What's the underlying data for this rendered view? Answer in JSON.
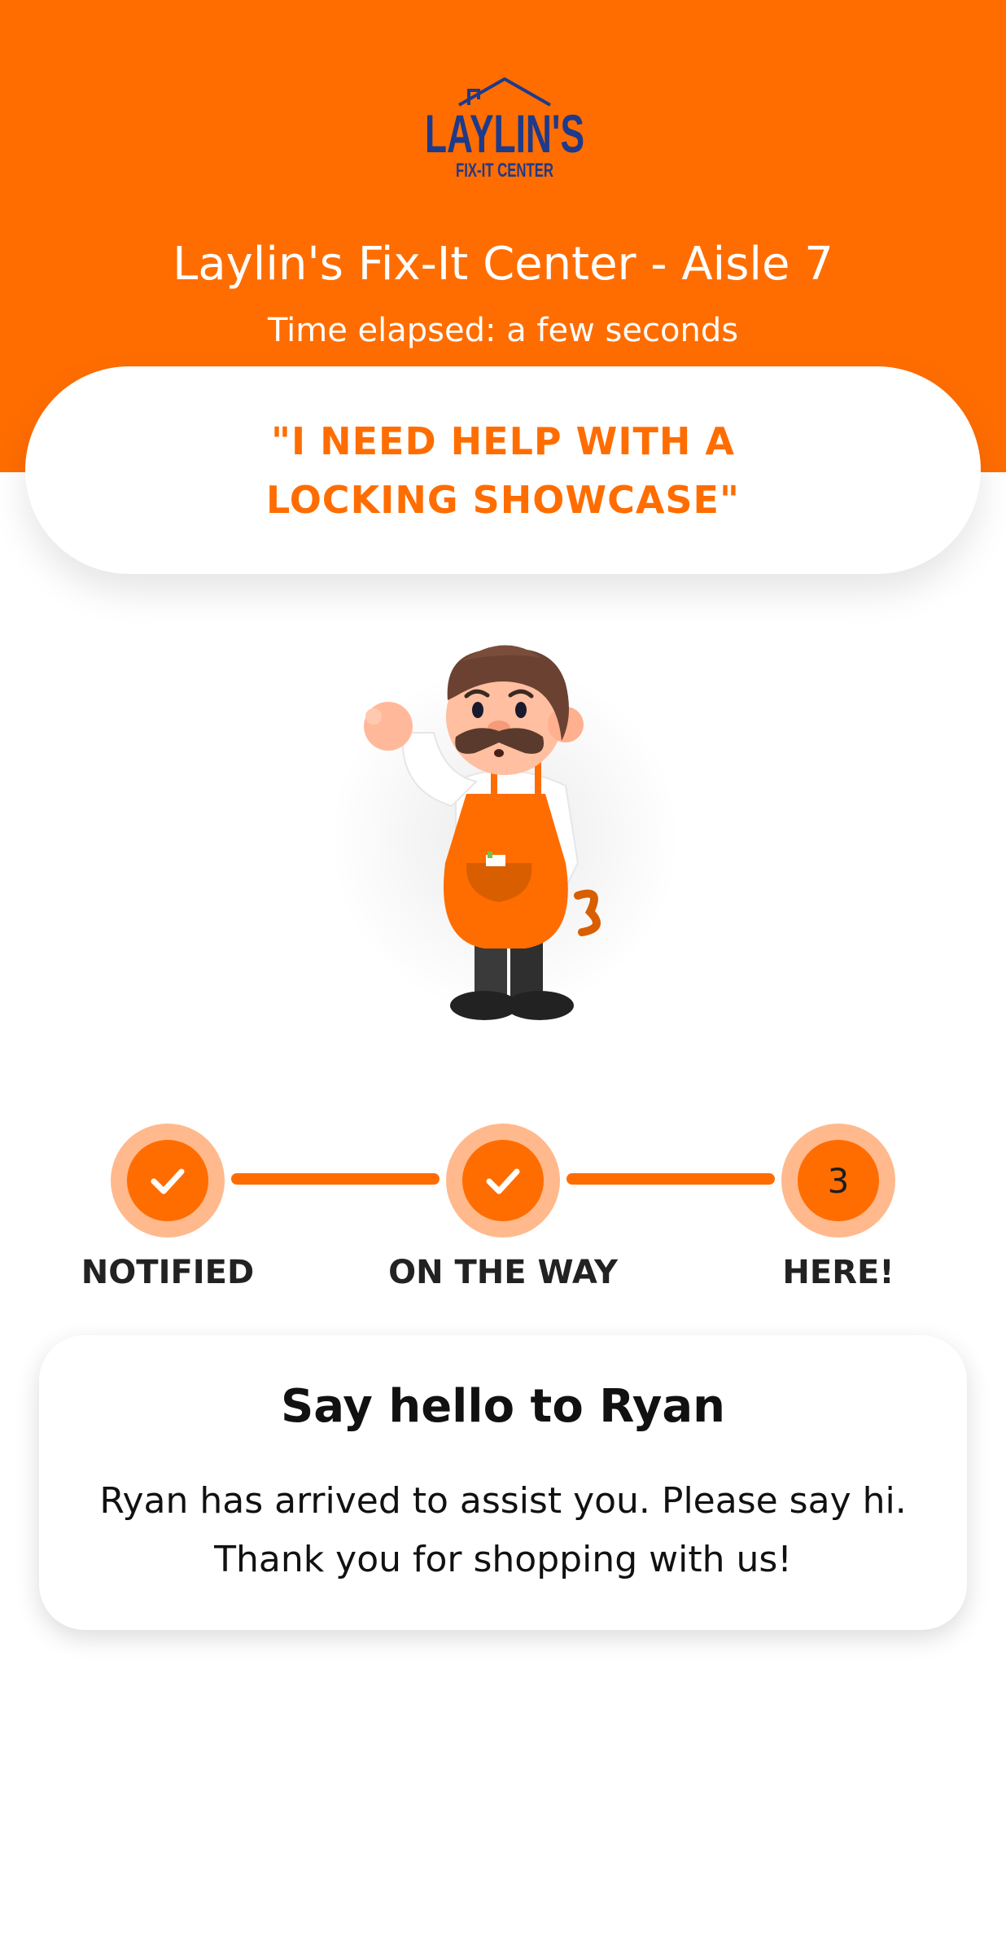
{
  "brand": {
    "logo_text": "LAYLIN'S",
    "logo_subtext": "FIX-IT CENTER",
    "logo_color": "#1e3a8a"
  },
  "header": {
    "title": "Laylin's Fix-It Center - Aisle 7",
    "time_elapsed": "Time elapsed: a few seconds",
    "background_color": "#ff6d00"
  },
  "request": {
    "text": "\"I NEED HELP WITH A LOCKING SHOWCASE\""
  },
  "illustration": {
    "icon": "store-associate-mascot-icon"
  },
  "progress": {
    "current_step": 3,
    "steps": [
      {
        "label": "NOTIFIED",
        "status": "complete",
        "icon": "checkmark-icon"
      },
      {
        "label": "ON THE WAY",
        "status": "complete",
        "icon": "checkmark-icon"
      },
      {
        "label": "HERE!",
        "status": "current",
        "number": "3"
      }
    ]
  },
  "status_card": {
    "title": "Say hello to Ryan",
    "message": "Ryan has arrived to assist you. Please say hi. Thank you for shopping with us!"
  },
  "colors": {
    "accent": "#ff6d00",
    "accent_light": "#ffb98c",
    "text_dark": "#111111"
  }
}
